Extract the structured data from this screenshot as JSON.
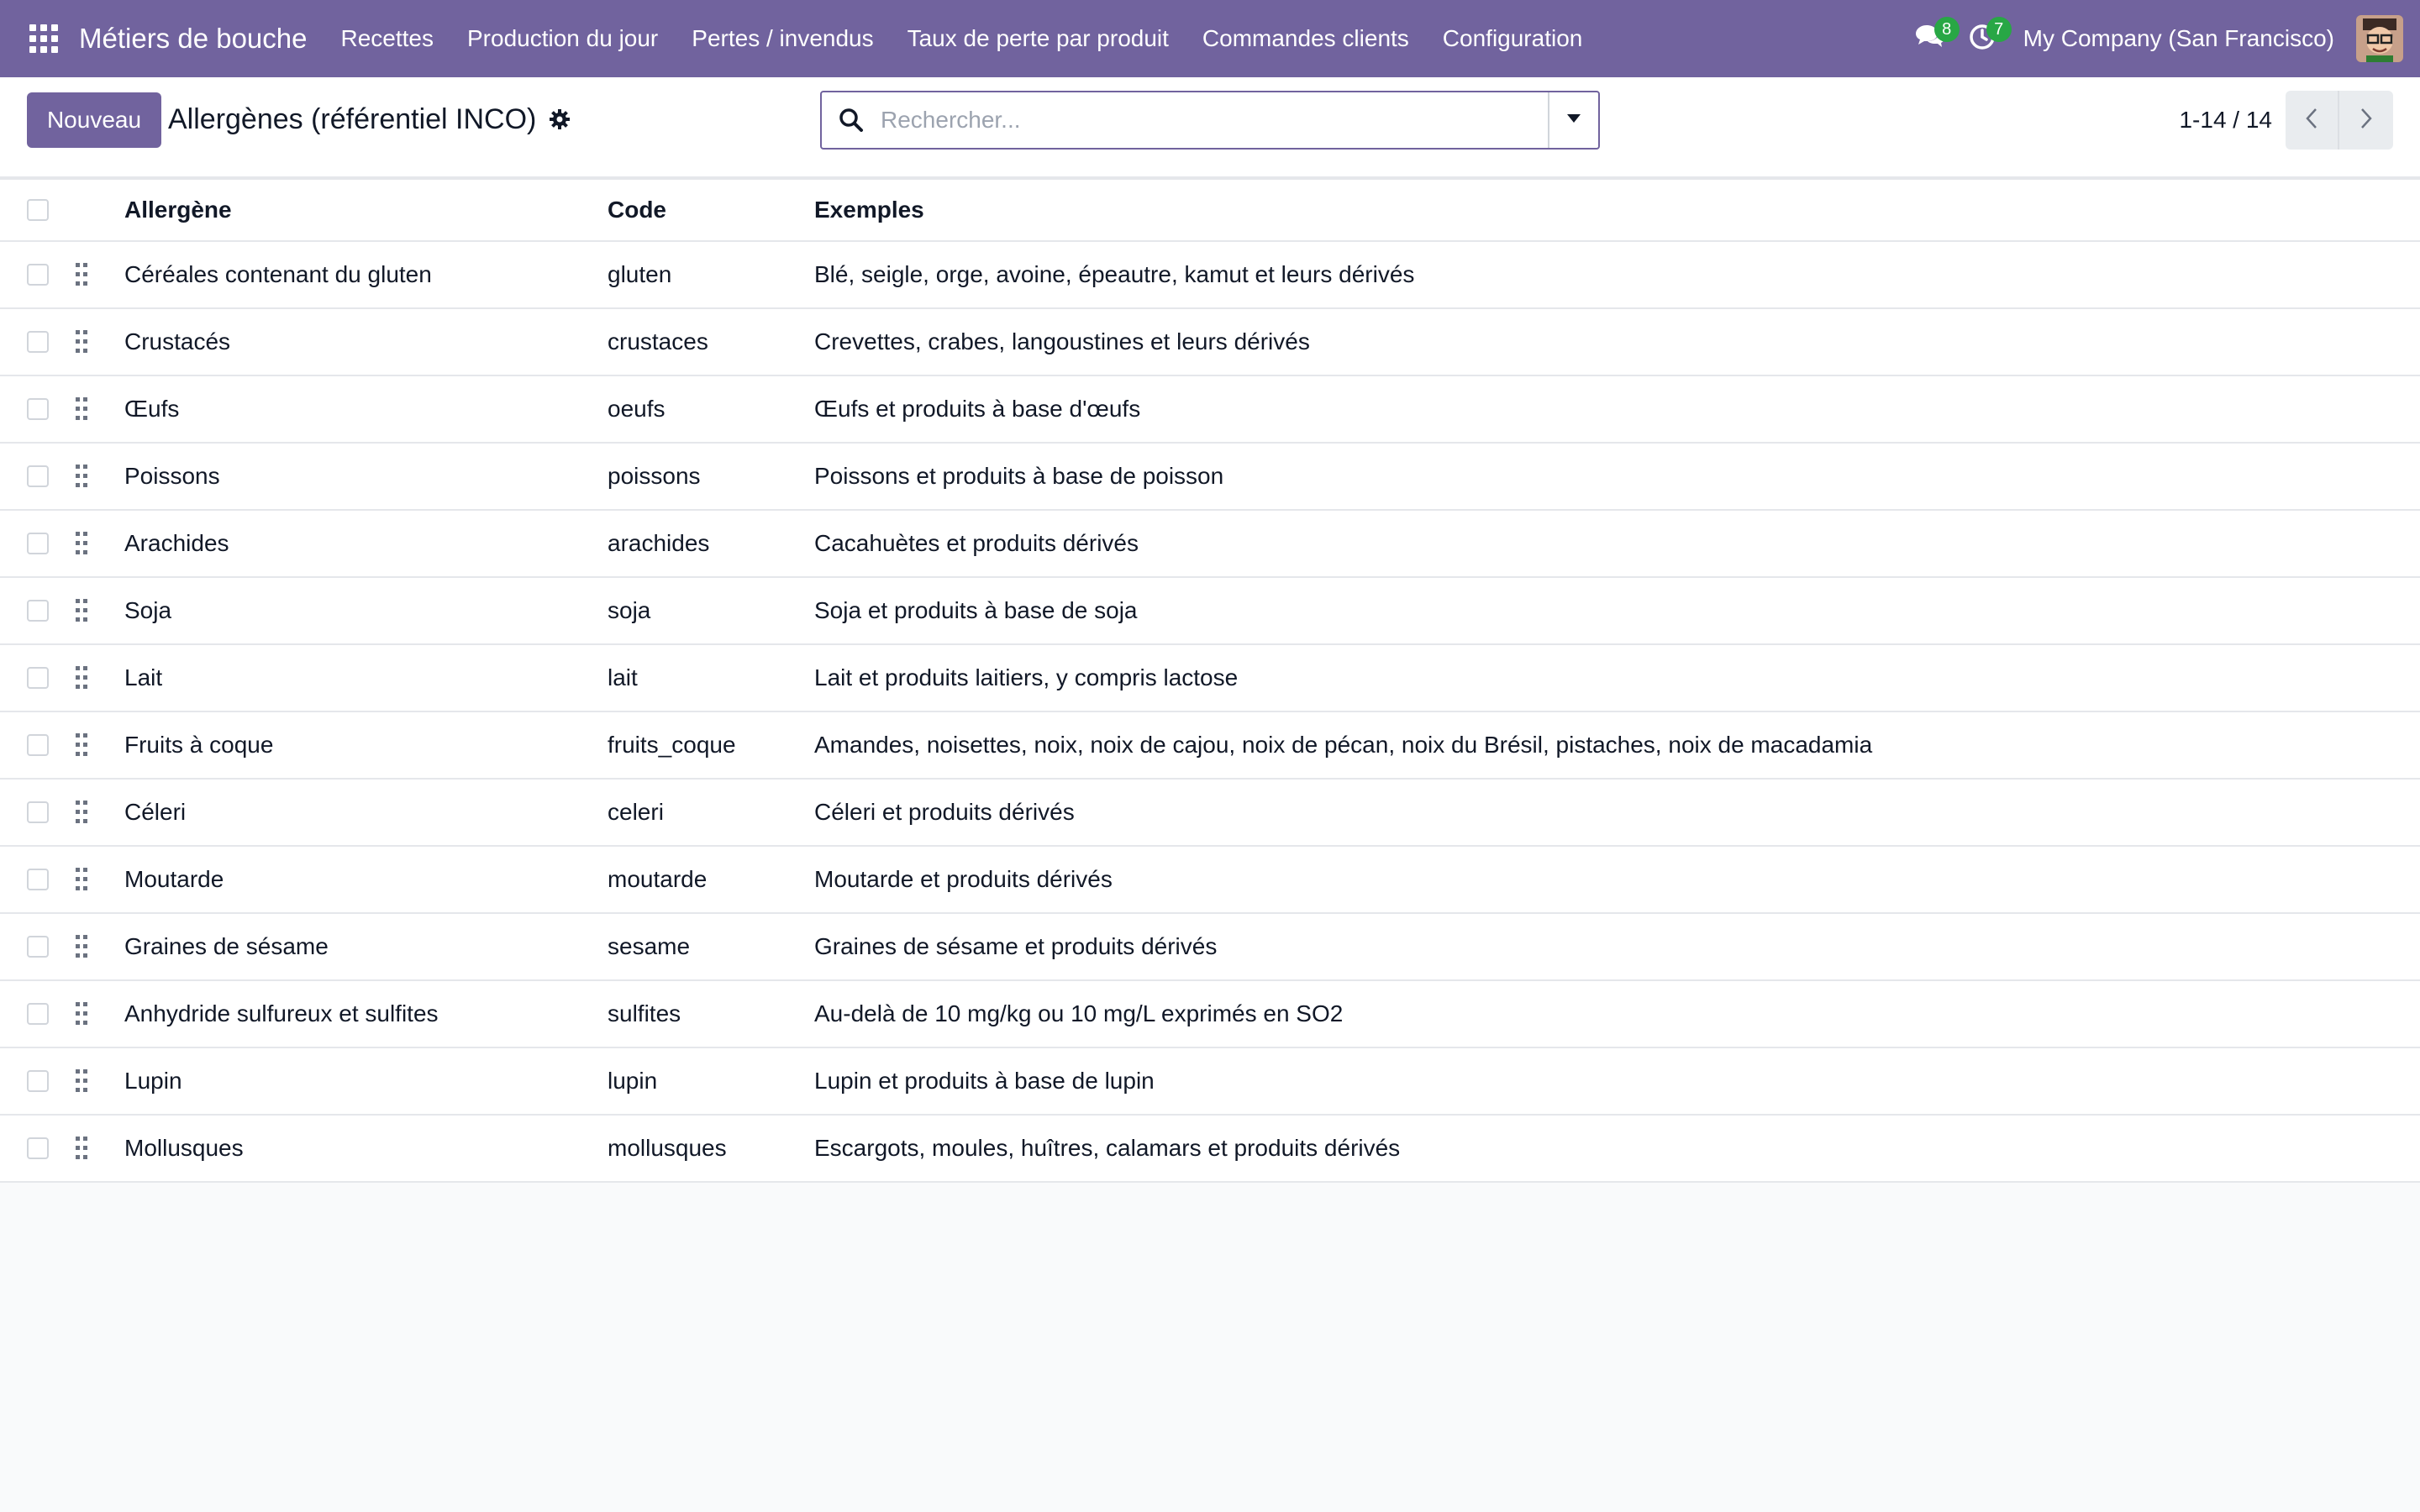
{
  "navbar": {
    "app_name": "Métiers de bouche",
    "menu": [
      "Recettes",
      "Production du jour",
      "Pertes / invendus",
      "Taux de perte par produit",
      "Commandes clients",
      "Configuration"
    ],
    "messages_count": "8",
    "activities_count": "7",
    "company": "My Company (San Francisco)",
    "accent_color": "#71639e",
    "badge_color": "#28a745"
  },
  "control_panel": {
    "new_button": "Nouveau",
    "title": "Allergènes (référentiel INCO)",
    "search_placeholder": "Rechercher...",
    "pager": "1-14 / 14"
  },
  "table": {
    "headers": {
      "name": "Allergène",
      "code": "Code",
      "examples": "Exemples"
    },
    "rows": [
      {
        "name": "Céréales contenant du gluten",
        "code": "gluten",
        "examples": "Blé, seigle, orge, avoine, épeautre, kamut et leurs dérivés"
      },
      {
        "name": "Crustacés",
        "code": "crustaces",
        "examples": "Crevettes, crabes, langoustines et leurs dérivés"
      },
      {
        "name": "Œufs",
        "code": "oeufs",
        "examples": "Œufs et produits à base d'œufs"
      },
      {
        "name": "Poissons",
        "code": "poissons",
        "examples": "Poissons et produits à base de poisson"
      },
      {
        "name": "Arachides",
        "code": "arachides",
        "examples": "Cacahuètes et produits dérivés"
      },
      {
        "name": "Soja",
        "code": "soja",
        "examples": "Soja et produits à base de soja"
      },
      {
        "name": "Lait",
        "code": "lait",
        "examples": "Lait et produits laitiers, y compris lactose"
      },
      {
        "name": "Fruits à coque",
        "code": "fruits_coque",
        "examples": "Amandes, noisettes, noix, noix de cajou, noix de pécan, noix du Brésil, pistaches, noix de macadamia"
      },
      {
        "name": "Céleri",
        "code": "celeri",
        "examples": "Céleri et produits dérivés"
      },
      {
        "name": "Moutarde",
        "code": "moutarde",
        "examples": "Moutarde et produits dérivés"
      },
      {
        "name": "Graines de sésame",
        "code": "sesame",
        "examples": "Graines de sésame et produits dérivés"
      },
      {
        "name": "Anhydride sulfureux et sulfites",
        "code": "sulfites",
        "examples": "Au-delà de 10 mg/kg ou 10 mg/L exprimés en SO2"
      },
      {
        "name": "Lupin",
        "code": "lupin",
        "examples": "Lupin et produits à base de lupin"
      },
      {
        "name": "Mollusques",
        "code": "mollusques",
        "examples": "Escargots, moules, huîtres, calamars et produits dérivés"
      }
    ]
  },
  "icons": {
    "apps": "apps-grid-icon",
    "messages": "chat-bubbles-icon",
    "activities": "clock-activity-icon",
    "settings": "gear-icon",
    "search": "search-icon",
    "dropdown": "caret-down-icon",
    "prev": "chevron-left-icon",
    "next": "chevron-right-icon",
    "handle": "drag-handle-icon"
  }
}
